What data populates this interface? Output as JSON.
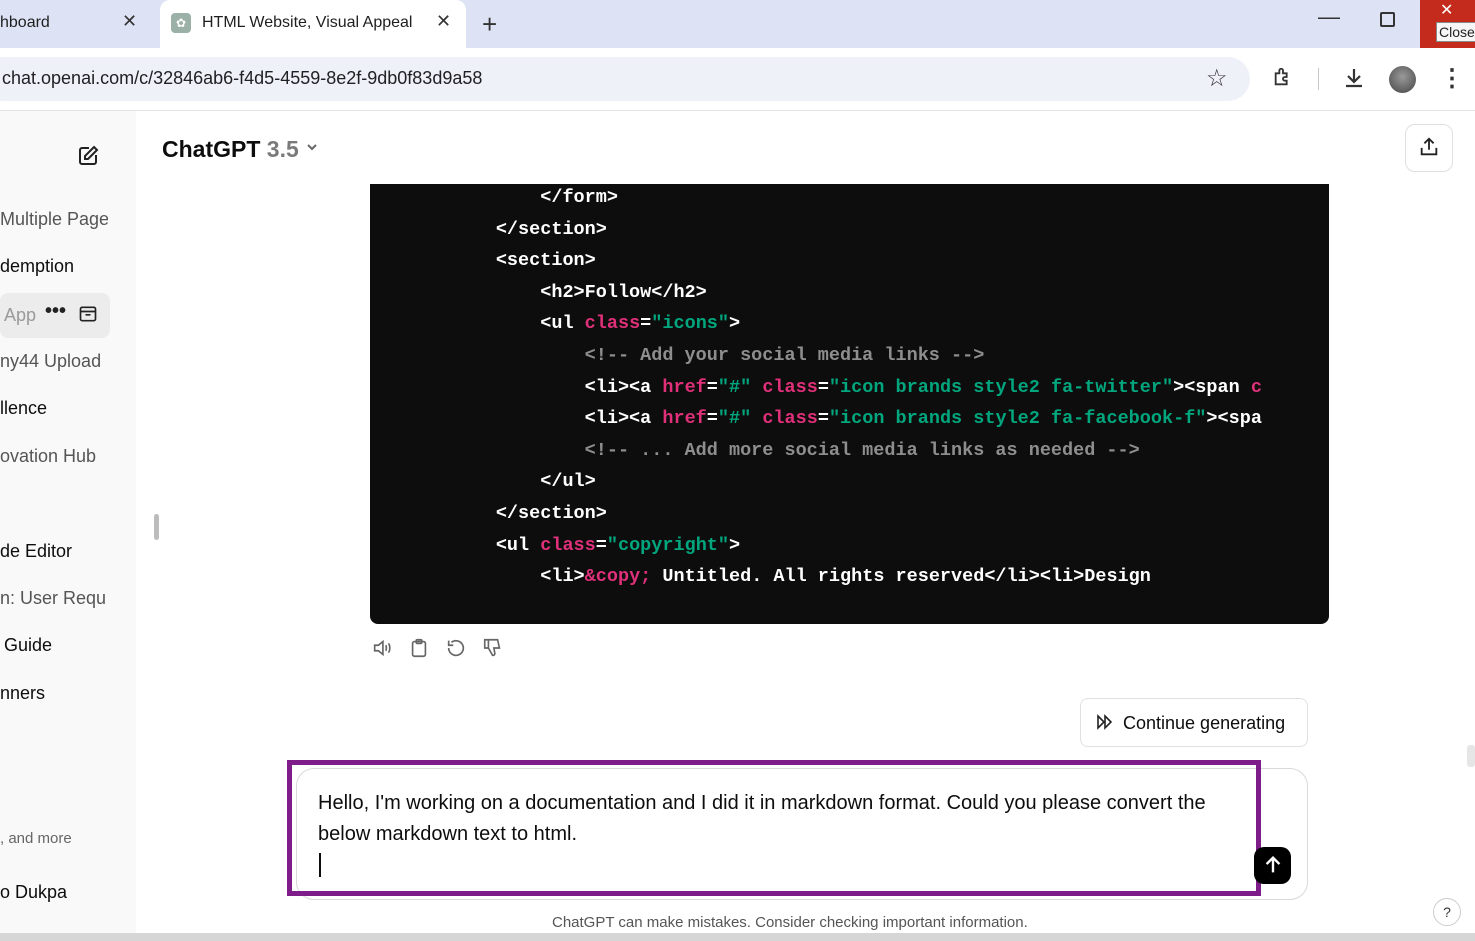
{
  "browser": {
    "tabs": [
      {
        "label": "hboard"
      },
      {
        "label": "HTML Website, Visual Appeal"
      }
    ],
    "close_tooltip": "Close",
    "url": "chat.openai.com/c/32846ab6-f4d5-4559-8e2f-9db0f83d9a58"
  },
  "sidebar": {
    "history": [
      "Multiple Pages",
      "demption",
      "App",
      "ny44 Upload",
      "llence",
      "ovation Hub",
      "de Editor",
      "n: User Requ",
      "Guide",
      "nners"
    ],
    "upgrade_text": ", and more",
    "user_name": "o Dukpa"
  },
  "header": {
    "model_name": "ChatGPT",
    "model_version": "3.5"
  },
  "code": {
    "lines": [
      {
        "indent": "            ",
        "segments": [
          {
            "t": "</form>",
            "c": ""
          }
        ]
      },
      {
        "indent": "        ",
        "segments": [
          {
            "t": "</section>",
            "c": ""
          }
        ]
      },
      {
        "indent": "        ",
        "segments": [
          {
            "t": "<section>",
            "c": ""
          }
        ]
      },
      {
        "indent": "            ",
        "segments": [
          {
            "t": "<h2>Follow</h2>",
            "c": ""
          }
        ]
      },
      {
        "indent": "            ",
        "segments": [
          {
            "t": "<ul ",
            "c": ""
          },
          {
            "t": "class",
            "c": "kw"
          },
          {
            "t": "=",
            "c": ""
          },
          {
            "t": "\"icons\"",
            "c": "str"
          },
          {
            "t": ">",
            "c": ""
          }
        ]
      },
      {
        "indent": "                ",
        "segments": [
          {
            "t": "<!-- Add your social media links -->",
            "c": "cm"
          }
        ]
      },
      {
        "indent": "                ",
        "segments": [
          {
            "t": "<li><a ",
            "c": ""
          },
          {
            "t": "href",
            "c": "kw"
          },
          {
            "t": "=",
            "c": ""
          },
          {
            "t": "\"#\"",
            "c": "str"
          },
          {
            "t": " ",
            "c": ""
          },
          {
            "t": "class",
            "c": "kw"
          },
          {
            "t": "=",
            "c": ""
          },
          {
            "t": "\"icon brands style2 fa-twitter\"",
            "c": "str"
          },
          {
            "t": "><span ",
            "c": ""
          },
          {
            "t": "c",
            "c": "kw"
          }
        ]
      },
      {
        "indent": "                ",
        "segments": [
          {
            "t": "<li><a ",
            "c": ""
          },
          {
            "t": "href",
            "c": "kw"
          },
          {
            "t": "=",
            "c": ""
          },
          {
            "t": "\"#\"",
            "c": "str"
          },
          {
            "t": " ",
            "c": ""
          },
          {
            "t": "class",
            "c": "kw"
          },
          {
            "t": "=",
            "c": ""
          },
          {
            "t": "\"icon brands style2 fa-facebook-f\"",
            "c": "str"
          },
          {
            "t": "><spa",
            "c": ""
          }
        ]
      },
      {
        "indent": "                ",
        "segments": [
          {
            "t": "<!-- ... Add more social media links as needed -->",
            "c": "cm"
          }
        ]
      },
      {
        "indent": "            ",
        "segments": [
          {
            "t": "</ul>",
            "c": ""
          }
        ]
      },
      {
        "indent": "        ",
        "segments": [
          {
            "t": "</section>",
            "c": ""
          }
        ]
      },
      {
        "indent": "        ",
        "segments": [
          {
            "t": "<ul ",
            "c": ""
          },
          {
            "t": "class",
            "c": "kw"
          },
          {
            "t": "=",
            "c": ""
          },
          {
            "t": "\"copyright\"",
            "c": "str"
          },
          {
            "t": ">",
            "c": ""
          }
        ]
      },
      {
        "indent": "            ",
        "segments": [
          {
            "t": "<li>",
            "c": ""
          },
          {
            "t": "&copy;",
            "c": "kw"
          },
          {
            "t": " Untitled. All rights reserved</li><li>Design",
            "c": ""
          }
        ]
      }
    ]
  },
  "composer": {
    "continue_label": "Continue generating",
    "prompt_text": "Hello, I'm working on a documentation and I did it in markdown format. Could you please convert the below markdown text to html.",
    "footer_note": "ChatGPT can make mistakes. Consider checking important information.",
    "help_label": "?"
  },
  "colors": {
    "highlight_border": "#7e1d8a",
    "code_background": "#0d0d0d",
    "keyword": "#df3079",
    "string": "#00a67d",
    "comment": "#8e8e8e",
    "window_close": "#c42b1c"
  }
}
